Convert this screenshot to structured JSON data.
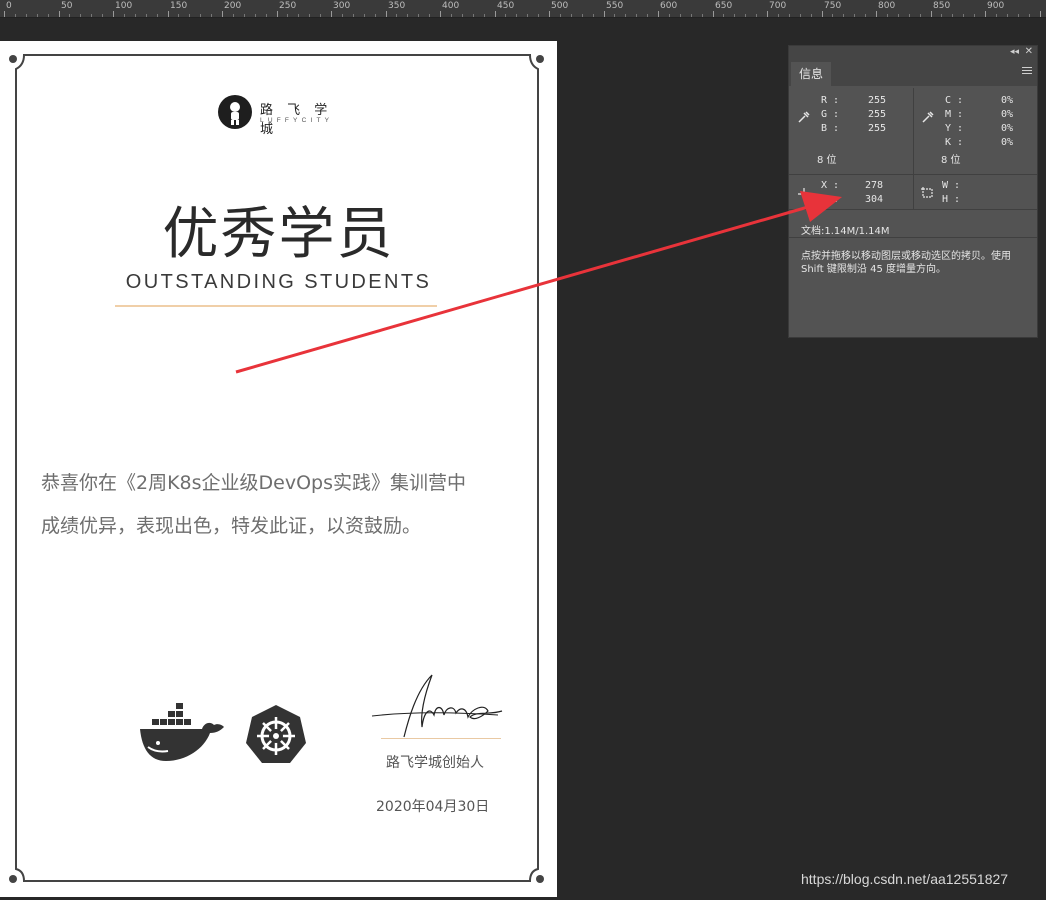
{
  "ruler": {
    "labels": [
      "0",
      "50",
      "100",
      "150",
      "200",
      "250",
      "300",
      "350",
      "400",
      "450",
      "500",
      "550",
      "600",
      "650",
      "700",
      "750",
      "800",
      "850",
      "900"
    ]
  },
  "certificate": {
    "logo_cn": "路 飞 学 城",
    "logo_en": "LUFFYCITY",
    "title_cn": "优秀学员",
    "title_en": "OUTSTANDING STUDENTS",
    "body_line1": "恭喜你在《2周K8s企业级DevOps实践》集训营中",
    "body_line2": "成绩优异，表现出色，特发此证，以资鼓励。",
    "signature_text": "Alex",
    "signer_title": "路飞学城创始人",
    "date": "2020年04月30日"
  },
  "info_panel": {
    "tab_label": "信息",
    "rgb": {
      "R": "255",
      "G": "255",
      "B": "255"
    },
    "cmyk": {
      "C": "0%",
      "M": "0%",
      "Y": "0%",
      "K": "0%"
    },
    "bit_depth_left": "8 位",
    "bit_depth_right": "8 位",
    "x_value": "278",
    "y_value": "304",
    "w_value": "",
    "h_value": "",
    "doc_size": "文档:1.14M/1.14M",
    "hint": "点按并拖移以移动图层或移动选区的拷贝。使用 Shift 键限制沿 45 度增量方向。"
  },
  "labels": {
    "R": "R :",
    "G": "G :",
    "B": "B :",
    "C": "C :",
    "M": "M :",
    "Y": "Y :",
    "K": "K :",
    "X": "X :",
    "Yc": "Y :",
    "W": "W :",
    "H": "H :"
  },
  "watermark": "https://blog.csdn.net/aa12551827",
  "colors": {
    "canvas_bg": "#282828",
    "panel_bg": "#535353",
    "arrow": "#e8333a",
    "accent_line": "#f0cfa8"
  }
}
